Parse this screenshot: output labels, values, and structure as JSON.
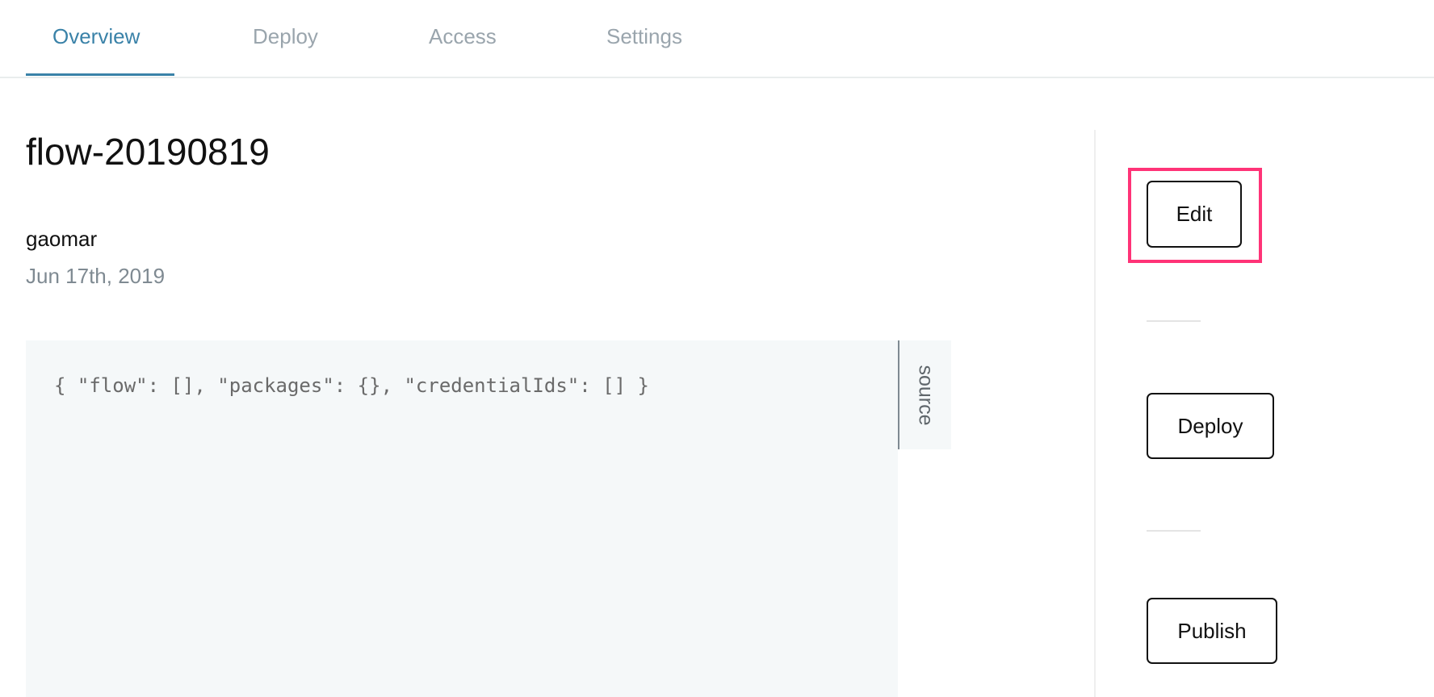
{
  "tabs": [
    {
      "label": "Overview",
      "active": true
    },
    {
      "label": "Deploy",
      "active": false
    },
    {
      "label": "Access",
      "active": false
    },
    {
      "label": "Settings",
      "active": false
    }
  ],
  "flow": {
    "title": "flow-20190819",
    "author": "gaomar",
    "date": "Jun 17th, 2019",
    "source_code": "{ \"flow\": [], \"packages\": {}, \"credentialIds\": [] }",
    "source_tab_label": "source"
  },
  "actions": {
    "edit_label": "Edit",
    "deploy_label": "Deploy",
    "publish_label": "Publish"
  },
  "colors": {
    "accent": "#3a82a8",
    "highlight": "#ff3377",
    "code_bg": "#f5f8f9"
  }
}
